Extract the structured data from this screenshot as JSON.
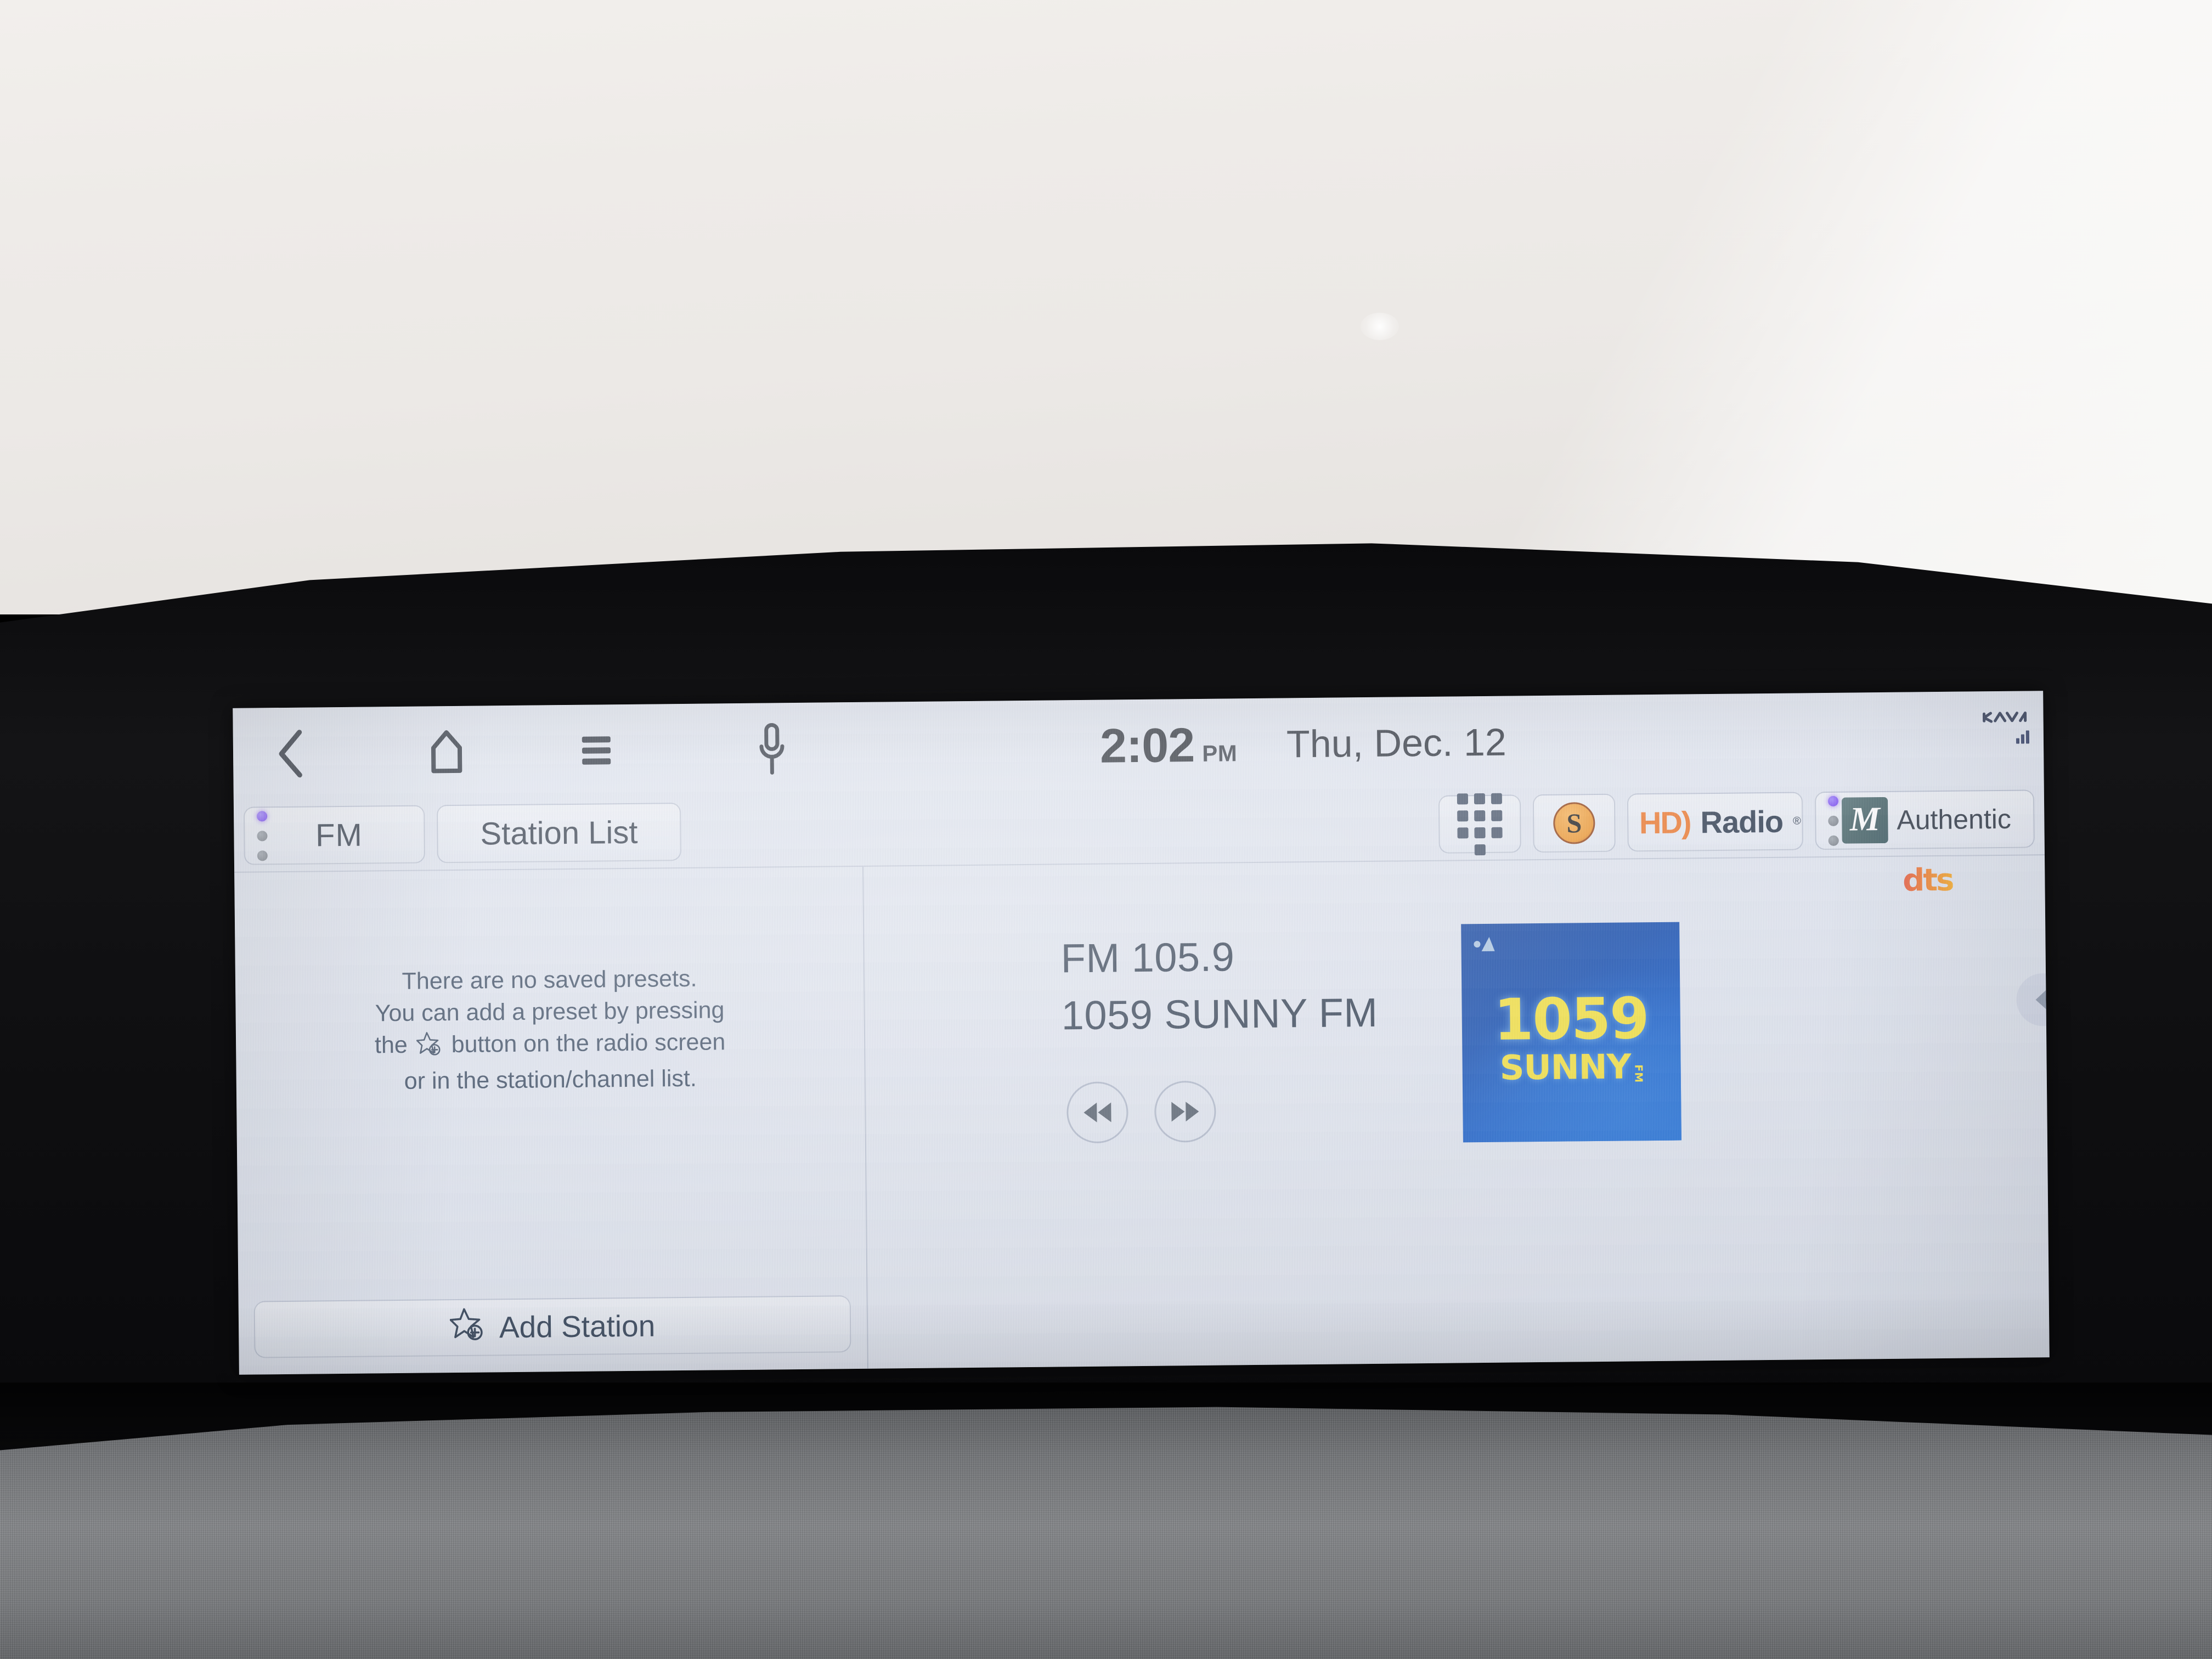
{
  "statusbar": {
    "back_icon": "chevron-left-icon",
    "home_icon": "home-icon",
    "menu_icon": "hamburger-menu-icon",
    "mic_icon": "microphone-icon",
    "time": "2:02",
    "ampm": "PM",
    "date": "Thu, Dec. 12",
    "brand_logo": "kia-logo",
    "signal_icon": "signal-bars-icon",
    "signal_bars_filled": 3
  },
  "tabbar": {
    "fm": {
      "label": "FM",
      "dots": [
        "on",
        "off",
        "off"
      ]
    },
    "station_list": {
      "label": "Station List"
    },
    "tools": {
      "keypad": {
        "icon": "keypad-icon"
      },
      "sound": {
        "icon": "soundhound-icon",
        "glyph": "S"
      },
      "hd_radio": {
        "mark": "HD)",
        "word": "Radio",
        "registered": "®",
        "indicator": "purple-bar"
      },
      "authentic": {
        "label": "Authentic",
        "logo": "meridian-m-logo",
        "logo_glyph": "M",
        "dots": [
          "on",
          "off",
          "off"
        ]
      }
    }
  },
  "preset_panel": {
    "empty_message_line1": "There are no saved presets.",
    "empty_message_line2": "You can add a preset by pressing",
    "empty_message_line3_pre": "the",
    "empty_message_line3_post": "button on the radio screen",
    "empty_message_line4": "or in the station/channel list.",
    "inline_icon": "star-plus-icon",
    "add_station": {
      "label": "Add Station",
      "icon": "star-plus-icon"
    }
  },
  "now_playing": {
    "frequency": "FM 105.9",
    "station_name": "1059 SUNNY FM",
    "seek_prev_icon": "seek-backward-icon",
    "seek_next_icon": "seek-forward-icon",
    "album_art": {
      "line1": "1059",
      "line2": "SUNNY",
      "line3": "FM",
      "corner_mark": "station-logo-mark"
    },
    "audio_badge": "dts",
    "flick_handle_icon": "chevron-left-icon"
  },
  "colors": {
    "screen_bg": "#dfe4ef",
    "text_primary": "#28364a",
    "accent_purple": "#6730ef",
    "hd_orange": "#ec7224",
    "album_blue": "#0c47ad",
    "album_yellow": "#f4e03a",
    "meridian_teal": "#3d5b60",
    "dts_orange": "#ef7c2c"
  }
}
